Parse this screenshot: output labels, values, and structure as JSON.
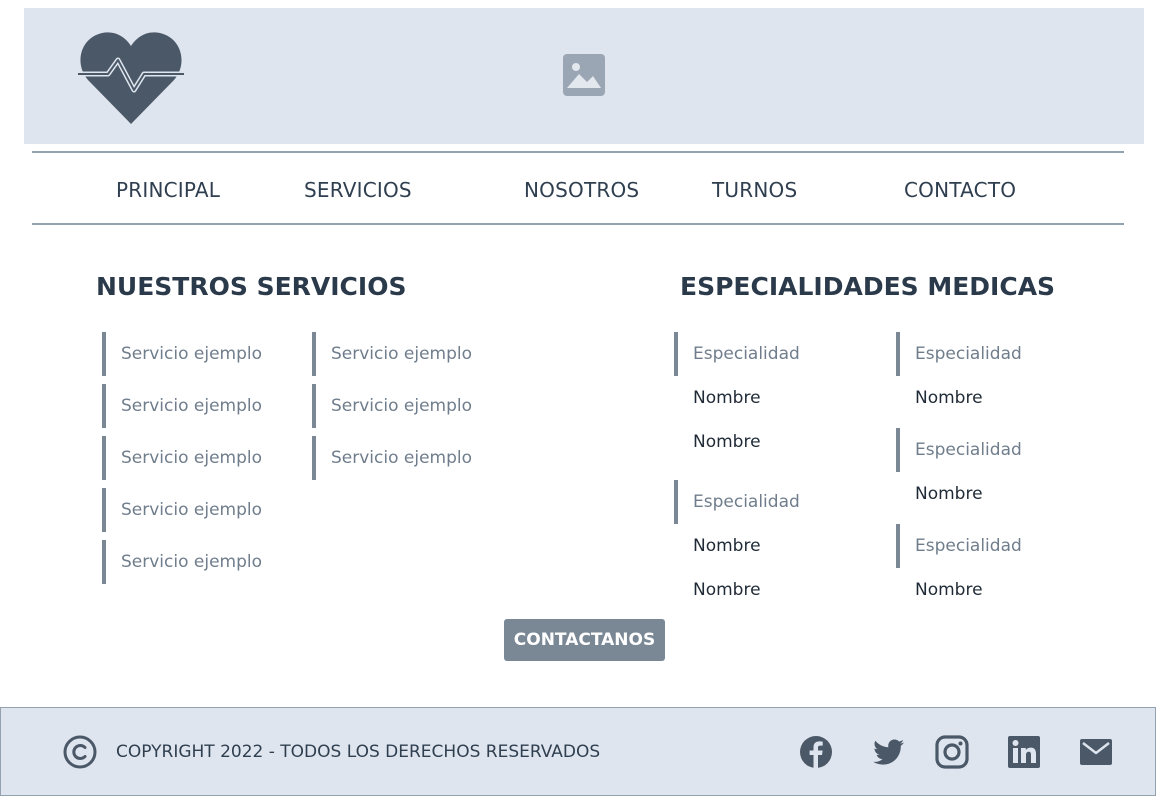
{
  "header": {
    "logo_icon": "heart-pulse-icon",
    "image_placeholder_icon": "image-placeholder-icon"
  },
  "nav": {
    "items": [
      {
        "label": "PRINCIPAL"
      },
      {
        "label": "SERVICIOS"
      },
      {
        "label": "NOSOTROS"
      },
      {
        "label": "TURNOS"
      },
      {
        "label": "CONTACTO"
      }
    ]
  },
  "servicios": {
    "title": "NUESTROS SERVICIOS",
    "col1": [
      "Servicio ejemplo",
      "Servicio ejemplo",
      "Servicio ejemplo",
      "Servicio ejemplo",
      "Servicio ejemplo"
    ],
    "col2": [
      "Servicio ejemplo",
      "Servicio ejemplo",
      "Servicio ejemplo"
    ]
  },
  "especialidades": {
    "title": "ESPECIALIDADES MEDICAS",
    "col1": [
      {
        "especialidad": "Especialidad",
        "nombres": [
          "Nombre",
          "Nombre"
        ]
      },
      {
        "especialidad": "Especialidad",
        "nombres": [
          "Nombre",
          "Nombre"
        ]
      }
    ],
    "col2": [
      {
        "especialidad": "Especialidad",
        "nombres": [
          "Nombre"
        ]
      },
      {
        "especialidad": "Especialidad",
        "nombres": [
          "Nombre"
        ]
      },
      {
        "especialidad": "Especialidad",
        "nombres": [
          "Nombre"
        ]
      }
    ]
  },
  "cta": {
    "label": "CONTACTANOS"
  },
  "footer": {
    "copyright_icon": "copyright-icon",
    "copyright_text": "COPYRIGHT 2022 - TODOS LOS DERECHOS RESERVADOS",
    "social_icons": [
      "facebook-icon",
      "twitter-icon",
      "instagram-icon",
      "linkedin-icon",
      "mail-icon"
    ]
  },
  "colors": {
    "header_bg": "#dfe5ee",
    "accent_gray": "#7a8896",
    "icon_dark": "#4a5868",
    "text_dark": "#2b3a4a"
  }
}
